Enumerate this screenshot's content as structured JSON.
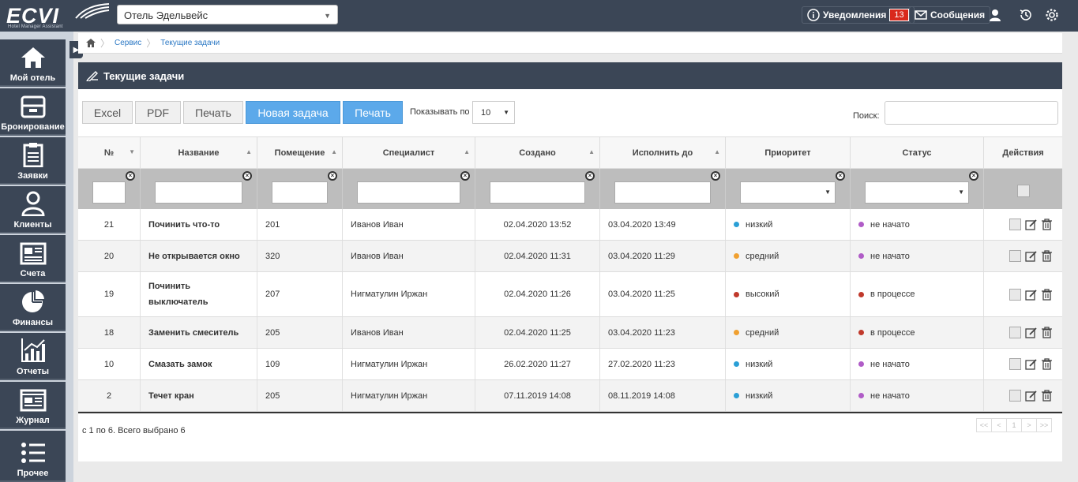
{
  "app": {
    "logo": "ECVI",
    "logo_sub": "Hotel Manager Assistant",
    "hotel": "Отель Эдельвейс"
  },
  "header": {
    "notifications_label": "Уведомления",
    "notifications_count": "13",
    "messages_label": "Сообщения"
  },
  "sidebar": {
    "items": [
      {
        "label": "Мой отель",
        "icon": "home-icon"
      },
      {
        "label": "Бронирование",
        "icon": "inbox-icon"
      },
      {
        "label": "Заявки",
        "icon": "clipboard-icon"
      },
      {
        "label": "Клиенты",
        "icon": "user-icon"
      },
      {
        "label": "Счета",
        "icon": "invoice-icon"
      },
      {
        "label": "Финансы",
        "icon": "pie-chart-icon"
      },
      {
        "label": "Отчеты",
        "icon": "bar-chart-icon"
      },
      {
        "label": "Журнал",
        "icon": "journal-icon"
      },
      {
        "label": "Прочее",
        "icon": "list-icon"
      }
    ]
  },
  "breadcrumb": {
    "items": [
      "Сервис",
      "Текущие задачи"
    ]
  },
  "panel": {
    "title": "Текущие задачи"
  },
  "toolbar": {
    "excel": "Excel",
    "pdf": "PDF",
    "print": "Печать",
    "new_task": "Новая задача",
    "print2": "Печать",
    "show_label": "Показывать по",
    "show_value": "10",
    "search_label": "Поиск:"
  },
  "table": {
    "columns": [
      "№",
      "Название",
      "Помещение",
      "Специалист",
      "Создано",
      "Исполнить до",
      "Приоритет",
      "Статус",
      "Действия"
    ],
    "rows": [
      {
        "num": "21",
        "name": "Починить что-то",
        "room": "201",
        "specialist": "Иванов Иван",
        "created": "02.04.2020 13:52",
        "due": "03.04.2020 13:49",
        "priority": "низкий",
        "priority_color": "#2a9fd6",
        "status": "не начато",
        "status_color": "#b05cc7"
      },
      {
        "num": "20",
        "name": "Не открывается окно",
        "room": "320",
        "specialist": "Иванов Иван",
        "created": "02.04.2020 11:31",
        "due": "03.04.2020 11:29",
        "priority": "средний",
        "priority_color": "#f0a030",
        "status": "не начато",
        "status_color": "#b05cc7"
      },
      {
        "num": "19",
        "name": "Починить выключатель",
        "room": "207",
        "specialist": "Нигматулин Иржан",
        "created": "02.04.2020 11:26",
        "due": "03.04.2020 11:25",
        "priority": "высокий",
        "priority_color": "#c0392b",
        "status": "в процессе",
        "status_color": "#c0392b"
      },
      {
        "num": "18",
        "name": "Заменить смеситель",
        "room": "205",
        "specialist": "Иванов Иван",
        "created": "02.04.2020 11:25",
        "due": "03.04.2020 11:23",
        "priority": "средний",
        "priority_color": "#f0a030",
        "status": "в процессе",
        "status_color": "#c0392b"
      },
      {
        "num": "10",
        "name": "Смазать замок",
        "room": "109",
        "specialist": "Нигматулин Иржан",
        "created": "26.02.2020 11:27",
        "due": "27.02.2020 11:23",
        "priority": "низкий",
        "priority_color": "#2a9fd6",
        "status": "не начато",
        "status_color": "#b05cc7"
      },
      {
        "num": "2",
        "name": "Течет кран",
        "room": "205",
        "specialist": "Нигматулин Иржан",
        "created": "07.11.2019 14:08",
        "due": "08.11.2019 14:08",
        "priority": "низкий",
        "priority_color": "#2a9fd6",
        "status": "не начато",
        "status_color": "#b05cc7"
      }
    ]
  },
  "footer": {
    "info": "с 1 по 6. Всего выбрано 6",
    "pager": [
      "<<",
      "<",
      "1",
      ">",
      ">>"
    ]
  }
}
